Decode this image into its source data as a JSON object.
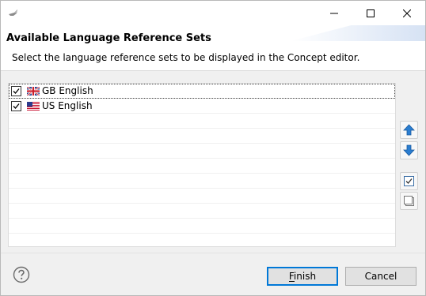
{
  "window": {
    "title": "",
    "controls": {
      "minimize": "minimize",
      "maximize": "maximize",
      "close": "close"
    }
  },
  "banner": {
    "title": "Available Language Reference Sets",
    "message": "Select the language reference sets to be displayed in the Concept editor."
  },
  "list": {
    "items": [
      {
        "label": "GB English",
        "checked": true,
        "flag_icon": "flag-gb-icon",
        "focused": true
      },
      {
        "label": "US English",
        "checked": true,
        "flag_icon": "flag-us-icon",
        "focused": false
      }
    ],
    "empty_rows": 9
  },
  "side_buttons": {
    "move_up": "arrow-up-icon",
    "move_down": "arrow-down-icon",
    "select_all": "check-all-icon",
    "deselect_all": "uncheck-all-icon"
  },
  "footer": {
    "help_icon": "help-icon",
    "finish_label": "Finish",
    "cancel_label": "Cancel"
  },
  "colors": {
    "accent": "#0078d7",
    "arrow_blue": "#1e73be"
  }
}
